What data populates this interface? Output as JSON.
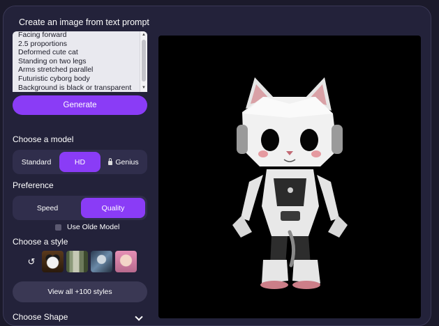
{
  "header": {
    "title": "Create an image from text prompt"
  },
  "prompt": {
    "lines": [
      "Facing forward",
      "2.5 proportions",
      "Deformed cute cat",
      "Standing on two legs",
      "Arms stretched parallel",
      "Futuristic cyborg body",
      "Background is black or transparent"
    ]
  },
  "generate_label": "Generate",
  "model": {
    "label": "Choose a model",
    "options": [
      "Standard",
      "HD",
      "Genius"
    ],
    "selected": "HD"
  },
  "preference": {
    "label": "Preference",
    "options": [
      "Speed",
      "Quality"
    ],
    "selected": "Quality"
  },
  "olde_model_label": "Use Olde Model",
  "style": {
    "label": "Choose a style",
    "thumbs": [
      "panda",
      "forest",
      "robot",
      "girl"
    ],
    "view_all_label": "View all +100 styles"
  },
  "shape": {
    "label": "Choose Shape"
  },
  "colors": {
    "accent": "#8a3cf6",
    "panel": "#23223a",
    "segment": "#302e4c"
  }
}
